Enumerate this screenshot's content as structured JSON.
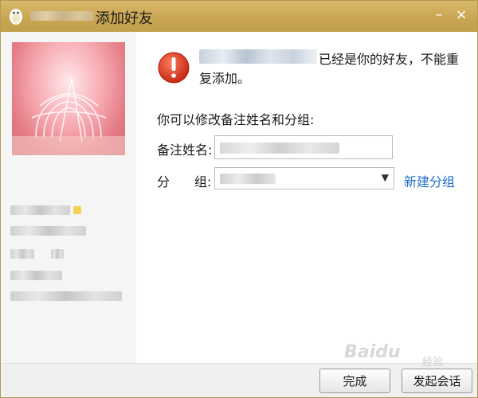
{
  "window": {
    "title": "添加好友",
    "minimize_glyph": "–",
    "close_glyph": "×"
  },
  "message": {
    "line1": "已经是你的好友，不能重",
    "line2": "复添加。"
  },
  "form": {
    "prompt": "你可以修改备注姓名和分组:",
    "remark_label": "备注姓名:",
    "group_label_char1": "分",
    "group_label_char2": "组:",
    "group_chevron": "▼",
    "new_group_link": "新建分组"
  },
  "buttons": {
    "done": "完成",
    "start_chat": "发起会话"
  },
  "watermark": {
    "latin": "Baidu",
    "cn": "经验"
  },
  "colors": {
    "titlebar": "#c9a552",
    "link": "#1f6fc9",
    "warning": "#d9341f"
  },
  "icons": {
    "title_logo": "qq-penguin-icon",
    "warning": "warning-icon"
  }
}
